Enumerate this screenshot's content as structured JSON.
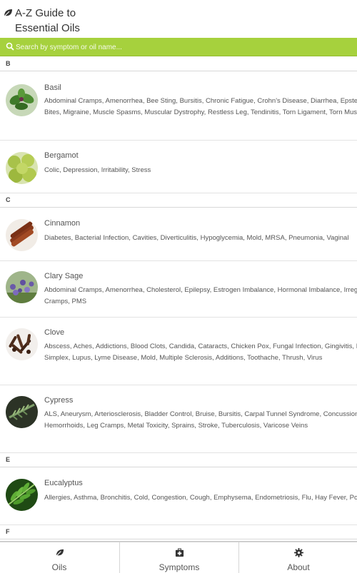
{
  "header": {
    "title_line1": "A-Z Guide to",
    "title_line2": "Essential Oils",
    "logo_icon": "leaf-icon"
  },
  "search": {
    "placeholder": "Search by symptom or oil name...",
    "value": "",
    "icon": "search-icon"
  },
  "sections": [
    {
      "letter": "B"
    },
    {
      "letter": "C"
    },
    {
      "letter": "E"
    },
    {
      "letter": "F"
    }
  ],
  "oils": [
    {
      "name": "Basil",
      "symptoms": "Abdominal Cramps, Amenorrhea, Bee Sting, Bursitis, Chronic Fatigue, Crohn's Disease, Diarrhea, Epstein-Barr, Fatigue, Insect Bites, Migraine, Muscle Spasms, Muscular Dystrophy, Restless Leg, Tendinitis, Torn Ligament, Torn Muscles, Vertigo"
    },
    {
      "name": "Bergamot",
      "symptoms": "Colic, Depression, Irritability, Stress"
    },
    {
      "name": "Cinnamon",
      "symptoms": "Diabetes, Bacterial Infection, Cavities, Diverticulitis, Hypoglycemia, Mold, MRSA, Pneumonia, Vaginal"
    },
    {
      "name": "Clary Sage",
      "symptoms": "Abdominal Cramps, Amenorrhea, Cholesterol, Epilepsy, Estrogen Imbalance, Hormonal Imbalance, Irregular Periods, Menstral Cramps, PMS"
    },
    {
      "name": "Clove",
      "symptoms": "Abscess, Aches, Addictions, Blood Clots, Candida, Cataracts, Chicken Pox, Fungal Infection, Gingivitis, Hypothyroidism, Herpes Simplex, Lupus, Lyme Disease, Mold, Multiple Sclerosis, Additions, Toothache, Thrush, Virus"
    },
    {
      "name": "Cypress",
      "symptoms": "ALS, Aneurysm, Arteriosclerosis, Bladder Control, Bruise, Bursitis, Carpal Tunnel Syndrome, Concussion, Dandruff, Hemorrhage, Hemorrhoids, Leg Cramps, Metal Toxicity, Sprains, Stroke, Tuberculosis, Varicose Veins"
    },
    {
      "name": "Eucalyptus",
      "symptoms": "Allergies, Asthma, Bronchitis, Cold, Congestion, Cough, Emphysema, Endometriosis, Flu, Hay Fever, Poison Ivy, Pneumonia"
    }
  ],
  "tabs": [
    {
      "label": "Oils",
      "icon": "leaf-icon"
    },
    {
      "label": "Symptoms",
      "icon": "first-aid-kit-icon"
    },
    {
      "label": "About",
      "icon": "gear-icon"
    }
  ],
  "colors": {
    "accent_green": "#a6d13d",
    "text": "#555555",
    "divider": "#e3e3e3"
  }
}
